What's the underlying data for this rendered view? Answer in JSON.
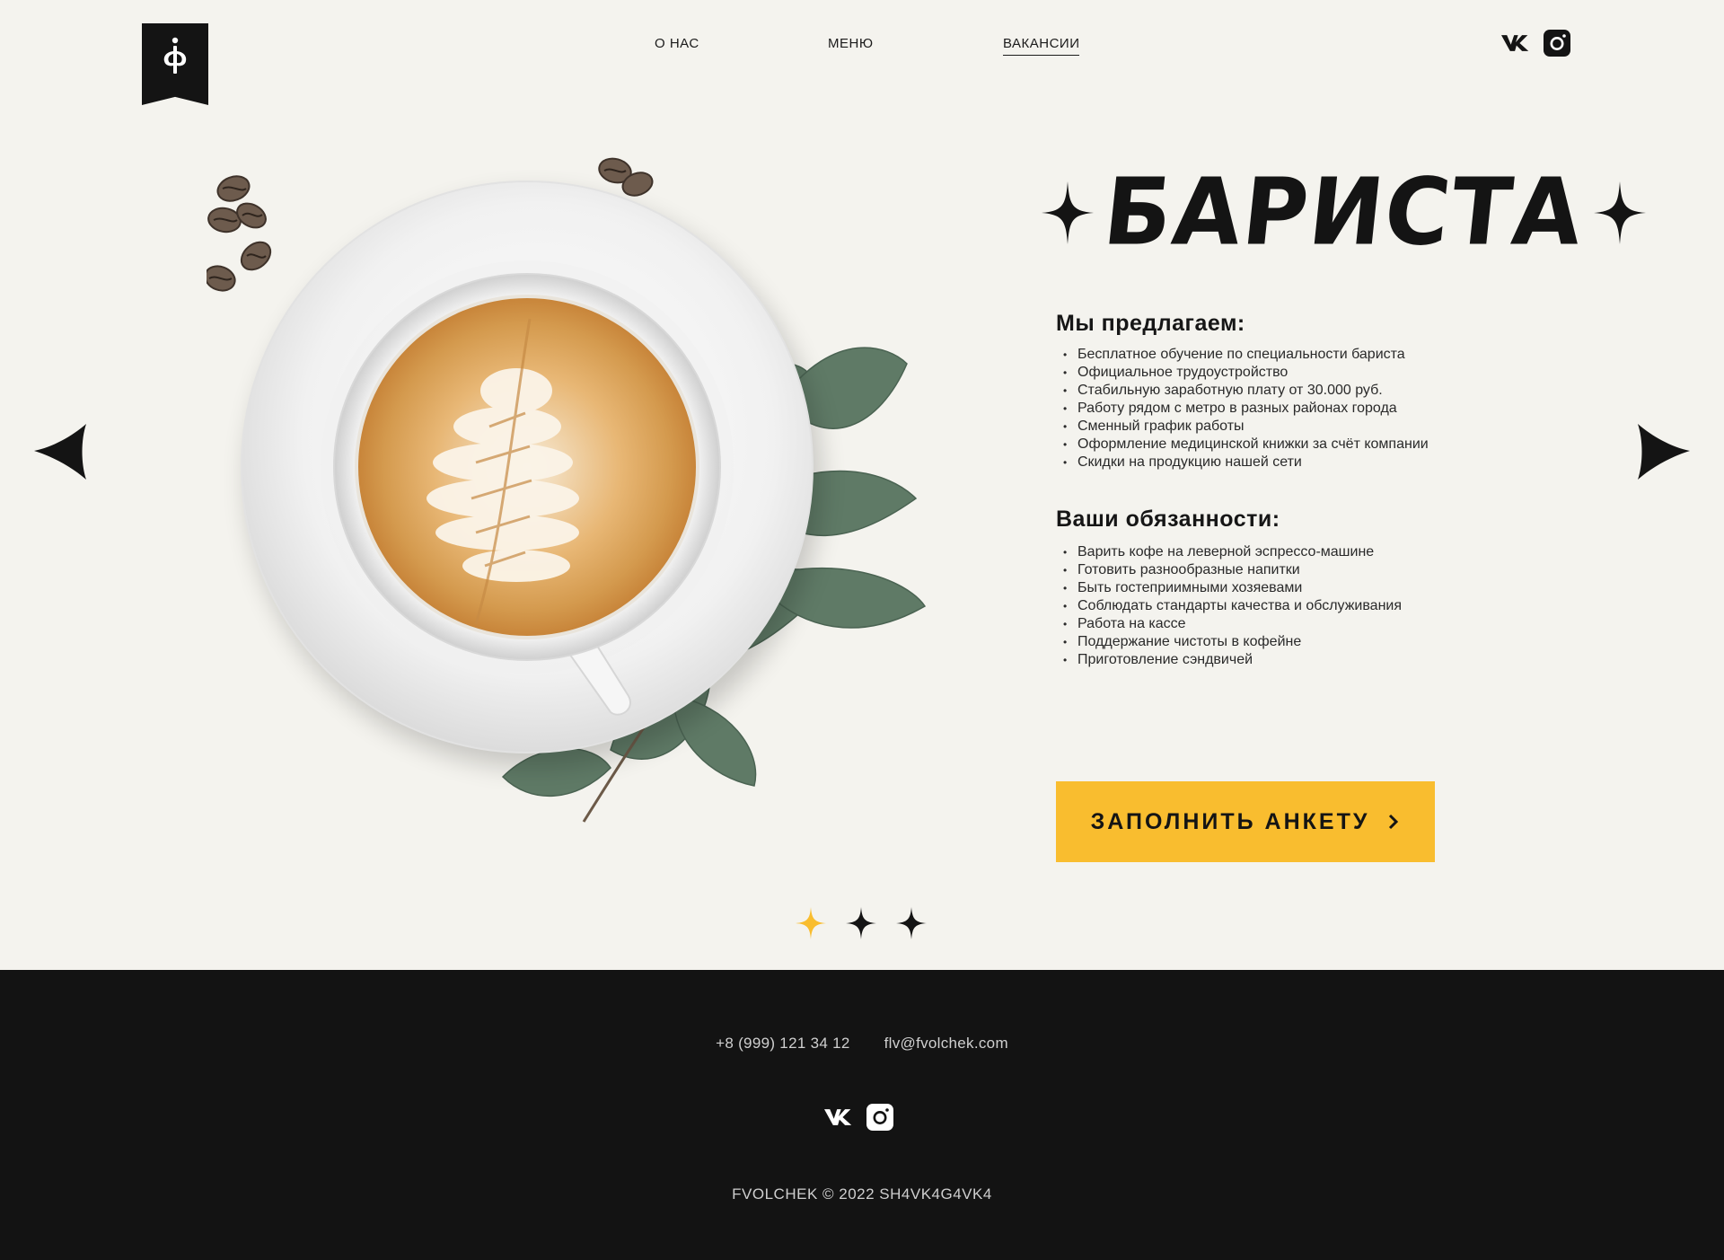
{
  "header": {
    "logo_alt": "ф",
    "nav": [
      {
        "label": "О НАС"
      },
      {
        "label": "МЕНЮ"
      },
      {
        "label": "ВАКАНСИИ"
      }
    ],
    "active_nav": "ВАКАНСИИ"
  },
  "vacancy": {
    "title": "БАРИСТА",
    "offer_heading": "Мы предлагаем:",
    "offer_items": [
      "Бесплатное обучение по специальности бариста",
      "Официальное трудоустройство",
      "Стабильную заработную плату от 30.000 руб.",
      "Работу рядом с метро в разных районах города",
      "Сменный график работы",
      "Оформление медицинской книжки за счёт компании",
      "Скидки на продукцию нашей сети"
    ],
    "duties_heading": "Ваши обязанности:",
    "duties_items": [
      "Варить кофе на леверной эспрессо-машине",
      "Готовить разнообразные напитки",
      "Быть гостеприимными хозяевами",
      "Соблюдать стандарты качества и обслуживания",
      "Работа на кассе",
      "Поддержание чистоты в кофейне",
      "Приготовление сэндвичей"
    ],
    "cta_label": "ЗАПОЛНИТЬ АНКЕТУ"
  },
  "slider": {
    "count": 3,
    "active_index": 0
  },
  "footer": {
    "phone": "+8 (999) 121 34 12",
    "email": "flv@fvolchek.com",
    "copyright": "FVOLCHEK © 2022 SH4VK4G4VK4"
  },
  "colors": {
    "background": "#f4f3ee",
    "dark": "#141414",
    "accent": "#f9bd2f",
    "footer_text": "#cfcfcf"
  },
  "icons": {
    "social": [
      "vk-icon",
      "instagram-icon"
    ],
    "arrows": [
      "arrow-left-icon",
      "arrow-right-icon"
    ],
    "decor": "four-point-star-icon"
  }
}
